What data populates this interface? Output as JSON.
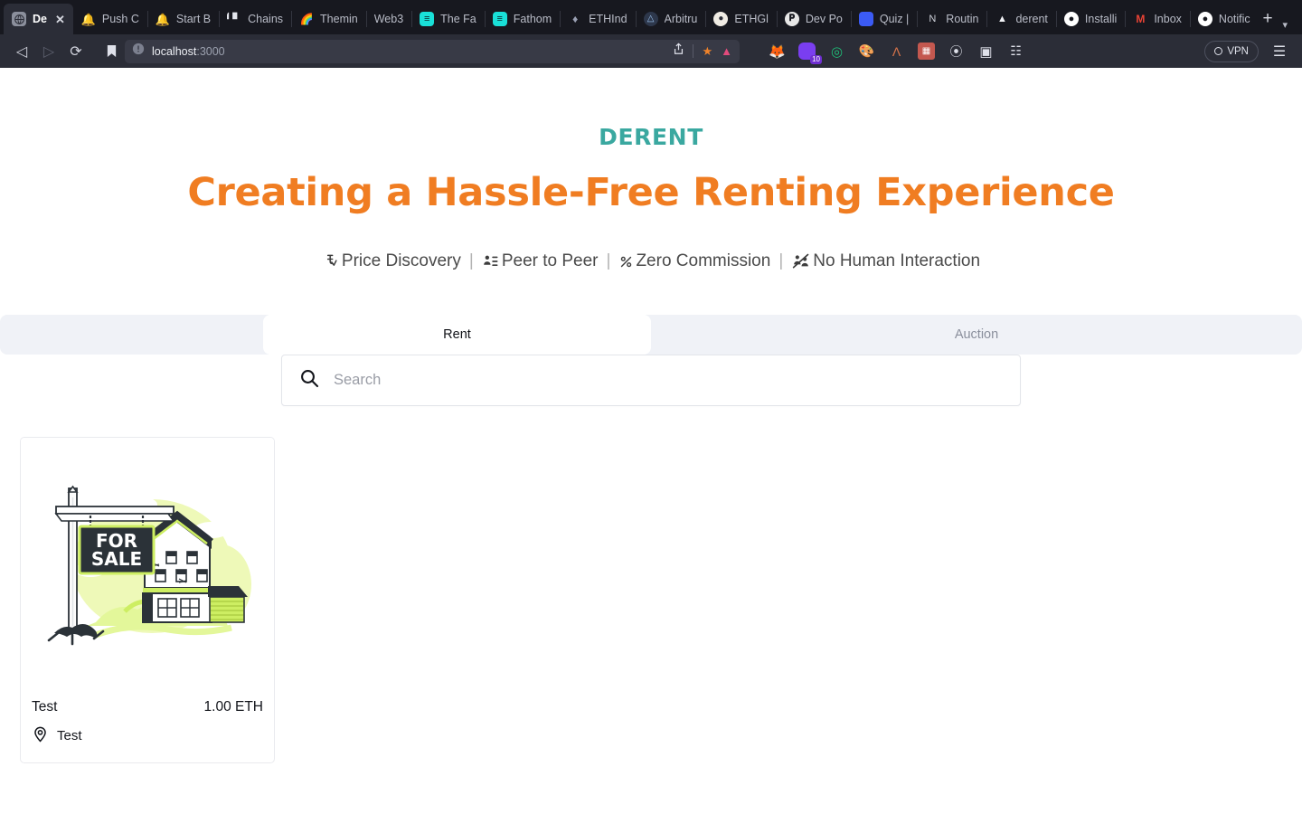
{
  "browser": {
    "tabs": [
      {
        "label": "De",
        "favicon": "globe-icon",
        "favicon_color": "#8b8f9c",
        "active": true
      },
      {
        "label": "Push C",
        "favicon": "bell-icon",
        "favicon_color": "#cf4bf0",
        "active": false
      },
      {
        "label": "Start B",
        "favicon": "bell-icon",
        "favicon_color": "#cf4bf0",
        "active": false
      },
      {
        "label": "Chains",
        "favicon": "bars-icon",
        "favicon_color": "#e6e8ef",
        "active": false
      },
      {
        "label": "Themin",
        "favicon": "rainbow-icon",
        "favicon_color": "#f0a64b",
        "active": false
      },
      {
        "label": "Web3",
        "favicon": "none-icon",
        "favicon_color": "transparent",
        "active": false
      },
      {
        "label": "The Fa",
        "favicon": "fathom-icon",
        "favicon_color": "#19e0d8",
        "active": false
      },
      {
        "label": "Fathom",
        "favicon": "fathom-icon",
        "favicon_color": "#19e0d8",
        "active": false
      },
      {
        "label": "ETHInd",
        "favicon": "eth-icon",
        "favicon_color": "#9aa0b3",
        "active": false
      },
      {
        "label": "Arbitru",
        "favicon": "arbitrum-icon",
        "favicon_color": "#2d374b",
        "active": false
      },
      {
        "label": "ETHGl",
        "favicon": "ethglobal-icon",
        "favicon_color": "#f0ece4",
        "active": false
      },
      {
        "label": "Dev Po",
        "favicon": "notion-icon",
        "favicon_color": "#e7e7e7",
        "active": false
      },
      {
        "label": "Quiz |",
        "favicon": "quiz-icon",
        "favicon_color": "#3b5bf5",
        "active": false
      },
      {
        "label": "Routin",
        "favicon": "notion-n-icon",
        "favicon_color": "#1a1a1a",
        "active": false
      },
      {
        "label": "derent",
        "favicon": "vercel-icon",
        "favicon_color": "#111111",
        "active": false
      },
      {
        "label": "Installi",
        "favicon": "github-icon",
        "favicon_color": "#ffffff",
        "active": false
      },
      {
        "label": "Inbox",
        "favicon": "gmail-icon",
        "favicon_color": "#ea4335",
        "active": false
      },
      {
        "label": "Notific",
        "favicon": "github-icon",
        "favicon_color": "#ffffff",
        "active": false
      }
    ],
    "new_tab_label": "+",
    "tab_list_chevron": "▾",
    "close_label": "✕",
    "nav": {
      "back_label": "◁",
      "forward_label": "▷",
      "reload_label": "⟳"
    },
    "url": {
      "host": "localhost",
      "port": ":3000",
      "site_info_icon": "info-circle-icon",
      "share_icon": "share-icon",
      "bookmark_icon": "bookmark-icon"
    },
    "extensions": [
      {
        "name": "metamask-icon",
        "glyph": "🦊",
        "color": "transparent",
        "badge": ""
      },
      {
        "name": "phantom-icon",
        "glyph": "◆",
        "color": "#7a3ef0",
        "badge": "10"
      },
      {
        "name": "rabby-icon",
        "glyph": "◎",
        "color": "transparent",
        "badge": ""
      },
      {
        "name": "colorpicker-icon",
        "glyph": "✿",
        "color": "transparent",
        "badge": ""
      },
      {
        "name": "keplr-icon",
        "glyph": "Λ",
        "color": "transparent",
        "badge": ""
      },
      {
        "name": "pixel-icon",
        "glyph": "▓",
        "color": "#c4584f",
        "badge": ""
      },
      {
        "name": "puzzle-icon",
        "glyph": "⬟",
        "color": "transparent",
        "badge": ""
      },
      {
        "name": "sidebar-icon",
        "glyph": "◧",
        "color": "transparent",
        "badge": ""
      },
      {
        "name": "wallet-icon",
        "glyph": "▤",
        "color": "transparent",
        "badge": ""
      }
    ],
    "vpn_label": "VPN",
    "menu_label": "☰"
  },
  "hero": {
    "brand": "DERENT",
    "headline": "Creating a Hassle-Free Renting Experience",
    "features": [
      {
        "icon": "price-tag-icon",
        "label": "Price Discovery"
      },
      {
        "icon": "people-icon",
        "label": "Peer to Peer"
      },
      {
        "icon": "percent-icon",
        "label": "Zero Commission"
      },
      {
        "icon": "no-human-icon",
        "label": "No Human Interaction"
      }
    ],
    "separator": "|"
  },
  "tabs": {
    "items": [
      {
        "label": "Rent",
        "selected": true
      },
      {
        "label": "Auction",
        "selected": false
      }
    ]
  },
  "search": {
    "placeholder": "Search",
    "value": "",
    "icon": "search-icon"
  },
  "listings": [
    {
      "title": "Test",
      "price": "1.00 ETH",
      "location": "Test",
      "location_icon": "map-pin-icon",
      "image_alt": "for-sale-house-illustration",
      "image_sign_line1": "FOR",
      "image_sign_line2": "SALE"
    }
  ],
  "colors": {
    "brand_teal": "#3aa8a0",
    "headline_orange": "#f07d22",
    "tabbar_bg": "#f0f2f7",
    "illustration_green": "#d6f25c",
    "illustration_dark": "#263238"
  }
}
